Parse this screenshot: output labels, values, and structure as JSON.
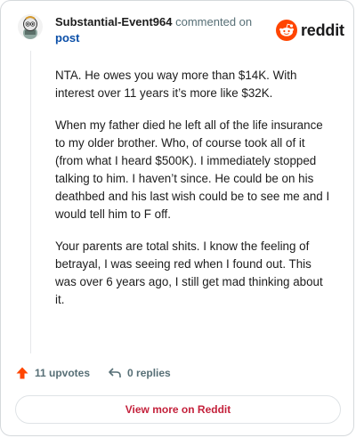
{
  "header": {
    "author": "Substantial-Event964",
    "commented_on": "commented on",
    "post_link": "post",
    "brand": "reddit"
  },
  "comment": {
    "paragraphs": [
      "NTA. He owes you way more than $14K. With interest over 11 years it’s more like $32K.",
      "When my father died he left all of the life insurance to my older brother. Who, of course took all of it (from what I heard $500K). I immediately stopped talking to him. I haven’t since. He could be on his deathbed and his last wish could be to see me and I would tell him to F off.",
      "Your parents are total shits. I know the feeling of betrayal, I was seeing red when I found out. This was over 6 years ago, I still get mad thinking about it."
    ]
  },
  "actions": {
    "upvotes": "11 upvotes",
    "replies": "0 replies"
  },
  "footer": {
    "view_more": "View more on Reddit"
  },
  "colors": {
    "upvote": "#ff4500",
    "brand": "#ff4500",
    "link": "#0b4fa8",
    "view_more": "#c4213b"
  },
  "icons": {
    "avatar": "snoo-avatar-icon",
    "brand": "reddit-logo-icon",
    "upvote": "upvote-arrow-icon",
    "reply": "reply-arrow-icon"
  }
}
